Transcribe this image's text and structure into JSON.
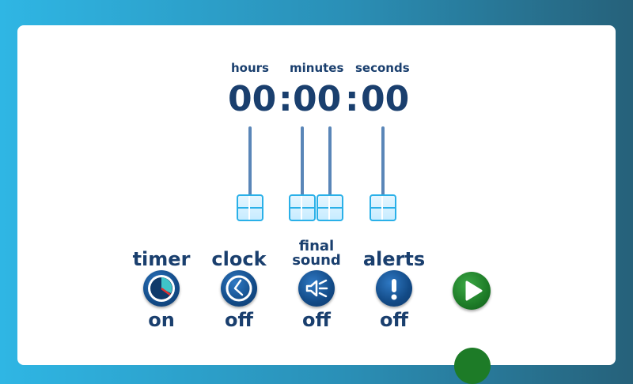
{
  "timer": {
    "labels": {
      "hours": "hours",
      "minutes": "minutes",
      "seconds": "seconds"
    },
    "display": {
      "hours": "00",
      "minutes": "00",
      "seconds": "00",
      "separator": ":"
    }
  },
  "sliders": [
    {
      "name": "hours-slider",
      "value": 0
    },
    {
      "name": "minutes-tens-slider",
      "value": 0
    },
    {
      "name": "minutes-ones-slider",
      "value": 0
    },
    {
      "name": "seconds-slider",
      "value": 0
    }
  ],
  "controls": {
    "timer": {
      "label": "timer",
      "state": "on",
      "icon": "timer-icon"
    },
    "clock": {
      "label": "clock",
      "state": "off",
      "icon": "clock-icon"
    },
    "final_sound": {
      "label_line1": "final",
      "label_line2": "sound",
      "state": "off",
      "icon": "sound-icon"
    },
    "alerts": {
      "label": "alerts",
      "state": "off",
      "icon": "alert-icon"
    }
  },
  "colors": {
    "primary": "#1a3f6e",
    "button_blue": "#124a86",
    "play_green": "#1d7b27",
    "slider_accent": "#2ab0e8"
  }
}
